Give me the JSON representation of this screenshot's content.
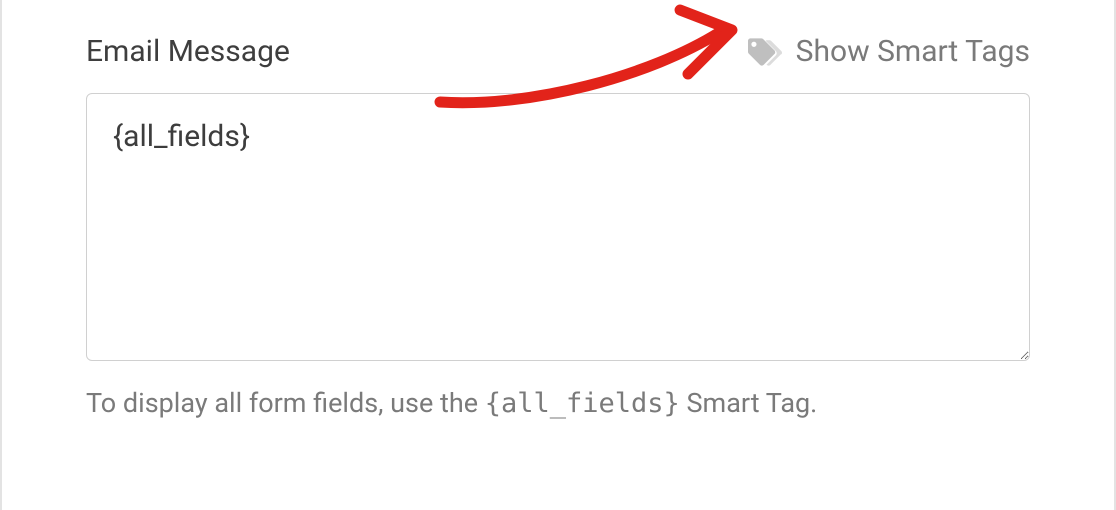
{
  "field": {
    "label": "Email Message",
    "value": "{all_fields}"
  },
  "smartTags": {
    "label": "Show Smart Tags"
  },
  "help": {
    "prefix": "To display all form fields, use the ",
    "code": "{all_fields}",
    "suffix": " Smart Tag."
  }
}
